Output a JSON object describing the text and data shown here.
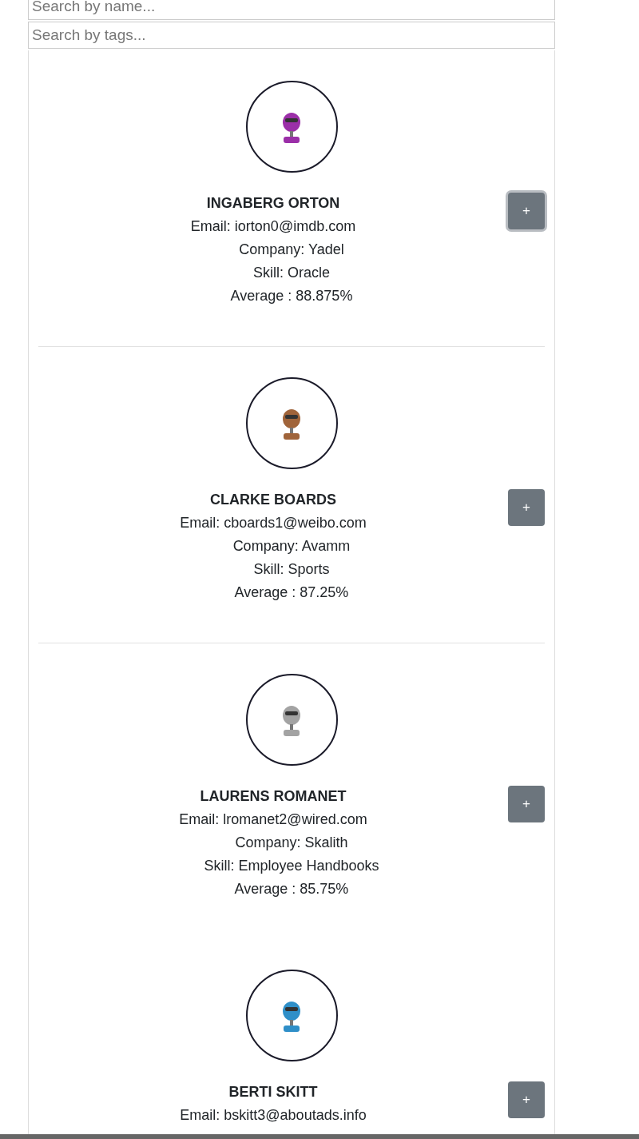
{
  "search_name": {
    "placeholder": "Search by name..."
  },
  "search_tags": {
    "placeholder": "Search by tags..."
  },
  "students": [
    {
      "name": "INGABERG ORTON",
      "email": "Email: iorton0@imdb.com",
      "company": "Company: Yadel",
      "skill": "Skill: Oracle",
      "average": "Average : 88.875%",
      "color": "#9b2fa8",
      "button": "+",
      "focused": true,
      "divider_below": true
    },
    {
      "name": "CLARKE BOARDS",
      "email": "Email: cboards1@weibo.com",
      "company": "Company: Avamm",
      "skill": "Skill: Sports",
      "average": "Average : 87.25%",
      "color": "#a0643a",
      "button": "+",
      "focused": false,
      "divider_below": true
    },
    {
      "name": "LAURENS ROMANET",
      "email": "Email: lromanet2@wired.com",
      "company": "Company: Skalith",
      "skill": "Skill: Employee Handbooks",
      "average": "Average : 85.75%",
      "color": "#a3a3a3",
      "button": "+",
      "focused": false
    },
    {
      "name": "BERTI SKITT",
      "email": "Email: bskitt3@aboutads.info",
      "color": "#2f8fc8",
      "button": "+",
      "focused": false
    }
  ]
}
